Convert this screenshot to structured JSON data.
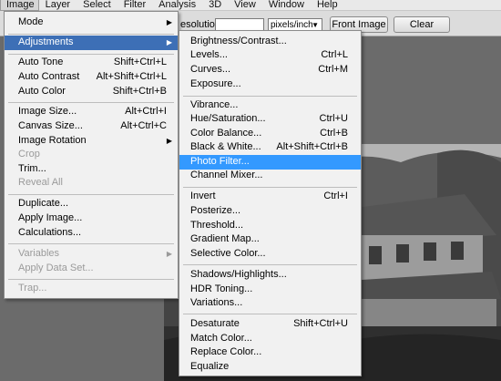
{
  "menubar": {
    "items": [
      "Image",
      "Layer",
      "Select",
      "Filter",
      "Analysis",
      "3D",
      "View",
      "Window",
      "Help"
    ]
  },
  "options": {
    "resolution_label": "esolution:",
    "resolution_value": "",
    "unit_value": "pixels/inch",
    "front_image_label": "Front Image",
    "clear_label": "Clear"
  },
  "image_menu": {
    "items": [
      {
        "label": "Mode",
        "shortcut": "",
        "arrow": true
      },
      {
        "label": "Adjustments",
        "shortcut": "",
        "arrow": true
      },
      {
        "label": "Auto Tone",
        "shortcut": "Shift+Ctrl+L"
      },
      {
        "label": "Auto Contrast",
        "shortcut": "Alt+Shift+Ctrl+L"
      },
      {
        "label": "Auto Color",
        "shortcut": "Shift+Ctrl+B"
      },
      {
        "label": "Image Size...",
        "shortcut": "Alt+Ctrl+I"
      },
      {
        "label": "Canvas Size...",
        "shortcut": "Alt+Ctrl+C"
      },
      {
        "label": "Image Rotation",
        "shortcut": "",
        "arrow": true
      },
      {
        "label": "Crop",
        "shortcut": "",
        "disabled": true
      },
      {
        "label": "Trim...",
        "shortcut": ""
      },
      {
        "label": "Reveal All",
        "shortcut": "",
        "disabled": true
      },
      {
        "label": "Duplicate...",
        "shortcut": ""
      },
      {
        "label": "Apply Image...",
        "shortcut": ""
      },
      {
        "label": "Calculations...",
        "shortcut": ""
      },
      {
        "label": "Variables",
        "shortcut": "",
        "arrow": true,
        "disabled": true
      },
      {
        "label": "Apply Data Set...",
        "shortcut": "",
        "disabled": true
      },
      {
        "label": "Trap...",
        "shortcut": "",
        "disabled": true
      }
    ]
  },
  "adjustments_menu": {
    "items": [
      {
        "label": "Brightness/Contrast...",
        "shortcut": ""
      },
      {
        "label": "Levels...",
        "shortcut": "Ctrl+L"
      },
      {
        "label": "Curves...",
        "shortcut": "Ctrl+M"
      },
      {
        "label": "Exposure...",
        "shortcut": ""
      },
      {
        "label": "Vibrance...",
        "shortcut": ""
      },
      {
        "label": "Hue/Saturation...",
        "shortcut": "Ctrl+U"
      },
      {
        "label": "Color Balance...",
        "shortcut": "Ctrl+B"
      },
      {
        "label": "Black & White...",
        "shortcut": "Alt+Shift+Ctrl+B"
      },
      {
        "label": "Photo Filter...",
        "shortcut": ""
      },
      {
        "label": "Channel Mixer...",
        "shortcut": ""
      },
      {
        "label": "Invert",
        "shortcut": "Ctrl+I"
      },
      {
        "label": "Posterize...",
        "shortcut": ""
      },
      {
        "label": "Threshold...",
        "shortcut": ""
      },
      {
        "label": "Gradient Map...",
        "shortcut": ""
      },
      {
        "label": "Selective Color...",
        "shortcut": ""
      },
      {
        "label": "Shadows/Highlights...",
        "shortcut": ""
      },
      {
        "label": "HDR Toning...",
        "shortcut": ""
      },
      {
        "label": "Variations...",
        "shortcut": ""
      },
      {
        "label": "Desaturate",
        "shortcut": "Shift+Ctrl+U"
      },
      {
        "label": "Match Color...",
        "shortcut": ""
      },
      {
        "label": "Replace Color...",
        "shortcut": ""
      },
      {
        "label": "Equalize",
        "shortcut": ""
      }
    ]
  },
  "colors": {
    "highlight": "#3399ff",
    "menu_bg": "#f1f1f1",
    "disabled": "#9a9a9a"
  }
}
